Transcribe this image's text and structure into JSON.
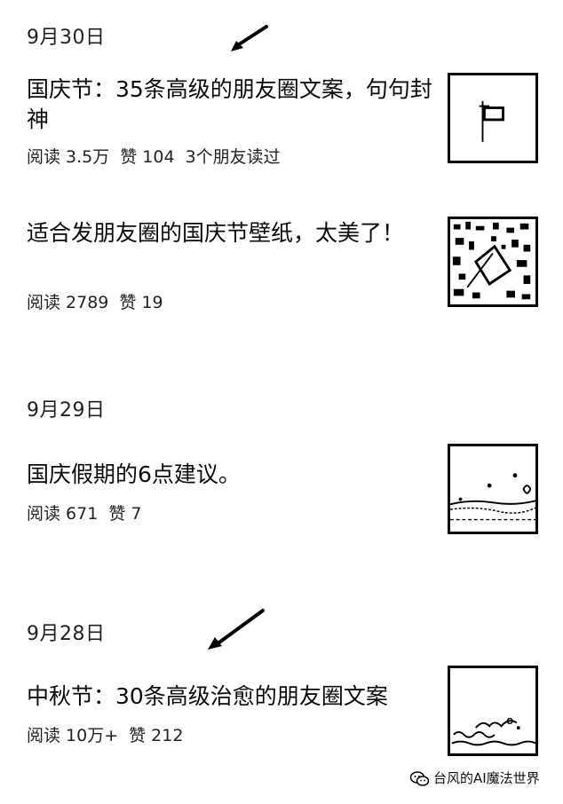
{
  "groups": [
    {
      "date": "9月30日",
      "articles": [
        {
          "title": "国庆节：35条高级的朋友圈文案，句句封神",
          "meta": {
            "reads": "阅读 3.5万",
            "likes": "赞 104",
            "friends": "3个朋友读过"
          },
          "thumb_icon": "flag-thumbnail"
        },
        {
          "title": "适合发朋友圈的国庆节壁纸，太美了！",
          "meta": {
            "reads": "阅读 2789",
            "likes": "赞 19"
          },
          "thumb_icon": "wallpaper-thumbnail"
        }
      ]
    },
    {
      "date": "9月29日",
      "articles": [
        {
          "title": "国庆假期的6点建议。",
          "meta": {
            "reads": "阅读 671",
            "likes": "赞 7"
          },
          "thumb_icon": "beach-thumbnail"
        }
      ]
    },
    {
      "date": "9月28日",
      "articles": [
        {
          "title": "中秋节：30条高级治愈的朋友圈文案",
          "meta": {
            "reads": "阅读 10万+",
            "likes": "赞 212"
          },
          "thumb_icon": "waves-thumbnail"
        }
      ]
    }
  ],
  "watermark": {
    "text": "台风的AI魔法世界",
    "icon": "wechat-icon"
  }
}
